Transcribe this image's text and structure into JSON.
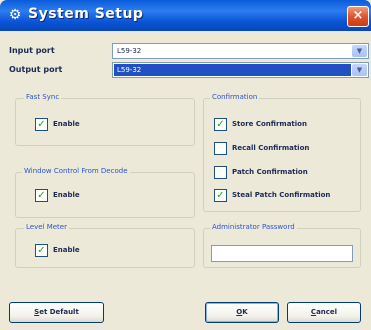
{
  "window": {
    "title": "System Setup",
    "close_glyph": "×",
    "icon": "gear-icon",
    "icon_glyph": "⚙"
  },
  "ports": {
    "input_label": "Input port",
    "input_value": "L59-32",
    "output_label": "Output port",
    "output_value": "L59-32",
    "dropdown_glyph": "▼"
  },
  "fast_sync": {
    "title": "Fast Sync",
    "enable_label": "Enable",
    "enable_checked": true
  },
  "window_control": {
    "title": "Window Control From Decode",
    "enable_label": "Enable",
    "enable_checked": true
  },
  "level_meter": {
    "title": "Level Meter",
    "enable_label": "Enable",
    "enable_checked": true
  },
  "confirmation": {
    "title": "Confirmation",
    "items": [
      {
        "label": "Store Confirmation",
        "checked": true
      },
      {
        "label": "Recall Confirmation",
        "checked": false
      },
      {
        "label": "Patch Confirmation",
        "checked": false
      },
      {
        "label": "Steal Patch Confirmation",
        "checked": true
      }
    ]
  },
  "admin": {
    "title": "Administrator Password",
    "password_value": ""
  },
  "buttons": {
    "set_default_u": "S",
    "set_default_rest": "et Default",
    "ok_u": "O",
    "ok_rest": "K",
    "cancel_u": "C",
    "cancel_rest": "ancel"
  },
  "checkmark_glyph": "✓",
  "colors": {
    "titlebar": "#0a5cd8",
    "dialog_bg": "#ece9d8",
    "selection": "#2150c4",
    "check_green": "#21a121",
    "group_title": "#2d55c8"
  }
}
